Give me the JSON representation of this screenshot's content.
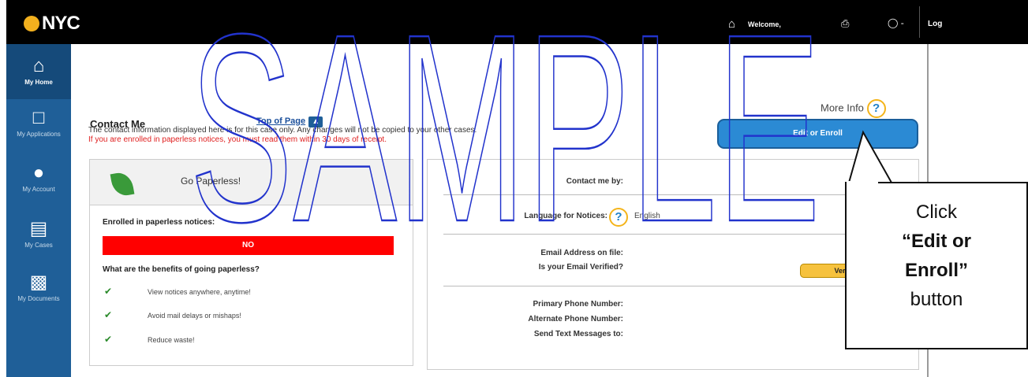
{
  "header": {
    "logo": "NYC",
    "welcome": "Welcome,",
    "logout": "Log"
  },
  "sidebar": {
    "items": [
      {
        "label": "My Home",
        "icon": "home-icon"
      },
      {
        "label": "My Applications",
        "icon": "document-icon"
      },
      {
        "label": "My Account",
        "icon": "user-icon"
      },
      {
        "label": "My Cases",
        "icon": "case-file-icon"
      },
      {
        "label": "My Documents",
        "icon": "documents-icon"
      }
    ]
  },
  "page": {
    "more_info": "More Info",
    "title": "Contact Me",
    "top_of_page": "Top of Page",
    "info_text": "The contact information displayed here is for this case only. Any changes will not be copied to your other cases.",
    "warning_text": "If you are enrolled in paperless notices, you must read them within 30 days of receipt.",
    "edit_button": "Edit or Enroll"
  },
  "paperless": {
    "title": "Go Paperless!",
    "enrolled_label": "Enrolled in paperless notices:",
    "enrolled_value": "NO",
    "benefits_question": "What are the benefits of going paperless?",
    "benefits": [
      "View notices anywhere, anytime!",
      "Avoid mail delays or mishaps!",
      "Reduce waste!"
    ]
  },
  "contact": {
    "contact_me_by": "Contact me by:",
    "language_label": "Language for Notices:",
    "language_value": "English",
    "email_label": "Email Address on file:",
    "email_verified_label": "Is your Email Verified?",
    "verify_button": "Verify",
    "primary_phone_label": "Primary Phone Number:",
    "alternate_phone_label": "Alternate Phone Number:",
    "text_messages_label": "Send Text Messages to:"
  },
  "callout": {
    "line1": "Click",
    "line2": "“Edit or",
    "line3": "Enroll”",
    "line4": "button"
  },
  "watermark": "SAMPLE",
  "colors": {
    "sidebar": "#1f5f98",
    "edit_button": "#2b8ad4",
    "no_bar": "#ff0000",
    "warning_text": "#e02020",
    "verify_button": "#f6c23e",
    "watermark_outline": "#2233cc"
  }
}
